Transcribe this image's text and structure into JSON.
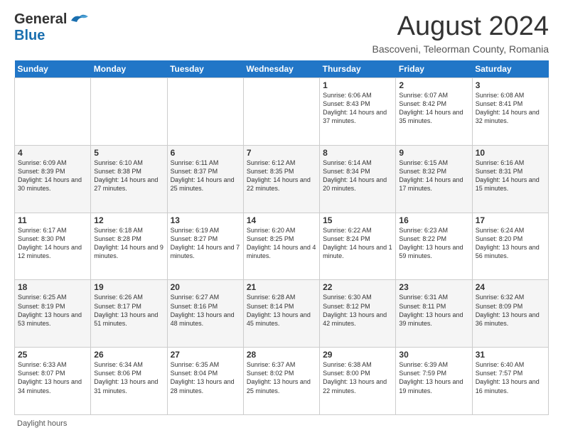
{
  "header": {
    "logo_general": "General",
    "logo_blue": "Blue",
    "title": "August 2024",
    "subtitle": "Bascoveni, Teleorman County, Romania"
  },
  "days_of_week": [
    "Sunday",
    "Monday",
    "Tuesday",
    "Wednesday",
    "Thursday",
    "Friday",
    "Saturday"
  ],
  "weeks": [
    [
      {
        "day": "",
        "info": ""
      },
      {
        "day": "",
        "info": ""
      },
      {
        "day": "",
        "info": ""
      },
      {
        "day": "",
        "info": ""
      },
      {
        "day": "1",
        "info": "Sunrise: 6:06 AM\nSunset: 8:43 PM\nDaylight: 14 hours\nand 37 minutes."
      },
      {
        "day": "2",
        "info": "Sunrise: 6:07 AM\nSunset: 8:42 PM\nDaylight: 14 hours\nand 35 minutes."
      },
      {
        "day": "3",
        "info": "Sunrise: 6:08 AM\nSunset: 8:41 PM\nDaylight: 14 hours\nand 32 minutes."
      }
    ],
    [
      {
        "day": "4",
        "info": "Sunrise: 6:09 AM\nSunset: 8:39 PM\nDaylight: 14 hours\nand 30 minutes."
      },
      {
        "day": "5",
        "info": "Sunrise: 6:10 AM\nSunset: 8:38 PM\nDaylight: 14 hours\nand 27 minutes."
      },
      {
        "day": "6",
        "info": "Sunrise: 6:11 AM\nSunset: 8:37 PM\nDaylight: 14 hours\nand 25 minutes."
      },
      {
        "day": "7",
        "info": "Sunrise: 6:12 AM\nSunset: 8:35 PM\nDaylight: 14 hours\nand 22 minutes."
      },
      {
        "day": "8",
        "info": "Sunrise: 6:14 AM\nSunset: 8:34 PM\nDaylight: 14 hours\nand 20 minutes."
      },
      {
        "day": "9",
        "info": "Sunrise: 6:15 AM\nSunset: 8:32 PM\nDaylight: 14 hours\nand 17 minutes."
      },
      {
        "day": "10",
        "info": "Sunrise: 6:16 AM\nSunset: 8:31 PM\nDaylight: 14 hours\nand 15 minutes."
      }
    ],
    [
      {
        "day": "11",
        "info": "Sunrise: 6:17 AM\nSunset: 8:30 PM\nDaylight: 14 hours\nand 12 minutes."
      },
      {
        "day": "12",
        "info": "Sunrise: 6:18 AM\nSunset: 8:28 PM\nDaylight: 14 hours\nand 9 minutes."
      },
      {
        "day": "13",
        "info": "Sunrise: 6:19 AM\nSunset: 8:27 PM\nDaylight: 14 hours\nand 7 minutes."
      },
      {
        "day": "14",
        "info": "Sunrise: 6:20 AM\nSunset: 8:25 PM\nDaylight: 14 hours\nand 4 minutes."
      },
      {
        "day": "15",
        "info": "Sunrise: 6:22 AM\nSunset: 8:24 PM\nDaylight: 14 hours\nand 1 minute."
      },
      {
        "day": "16",
        "info": "Sunrise: 6:23 AM\nSunset: 8:22 PM\nDaylight: 13 hours\nand 59 minutes."
      },
      {
        "day": "17",
        "info": "Sunrise: 6:24 AM\nSunset: 8:20 PM\nDaylight: 13 hours\nand 56 minutes."
      }
    ],
    [
      {
        "day": "18",
        "info": "Sunrise: 6:25 AM\nSunset: 8:19 PM\nDaylight: 13 hours\nand 53 minutes."
      },
      {
        "day": "19",
        "info": "Sunrise: 6:26 AM\nSunset: 8:17 PM\nDaylight: 13 hours\nand 51 minutes."
      },
      {
        "day": "20",
        "info": "Sunrise: 6:27 AM\nSunset: 8:16 PM\nDaylight: 13 hours\nand 48 minutes."
      },
      {
        "day": "21",
        "info": "Sunrise: 6:28 AM\nSunset: 8:14 PM\nDaylight: 13 hours\nand 45 minutes."
      },
      {
        "day": "22",
        "info": "Sunrise: 6:30 AM\nSunset: 8:12 PM\nDaylight: 13 hours\nand 42 minutes."
      },
      {
        "day": "23",
        "info": "Sunrise: 6:31 AM\nSunset: 8:11 PM\nDaylight: 13 hours\nand 39 minutes."
      },
      {
        "day": "24",
        "info": "Sunrise: 6:32 AM\nSunset: 8:09 PM\nDaylight: 13 hours\nand 36 minutes."
      }
    ],
    [
      {
        "day": "25",
        "info": "Sunrise: 6:33 AM\nSunset: 8:07 PM\nDaylight: 13 hours\nand 34 minutes."
      },
      {
        "day": "26",
        "info": "Sunrise: 6:34 AM\nSunset: 8:06 PM\nDaylight: 13 hours\nand 31 minutes."
      },
      {
        "day": "27",
        "info": "Sunrise: 6:35 AM\nSunset: 8:04 PM\nDaylight: 13 hours\nand 28 minutes."
      },
      {
        "day": "28",
        "info": "Sunrise: 6:37 AM\nSunset: 8:02 PM\nDaylight: 13 hours\nand 25 minutes."
      },
      {
        "day": "29",
        "info": "Sunrise: 6:38 AM\nSunset: 8:00 PM\nDaylight: 13 hours\nand 22 minutes."
      },
      {
        "day": "30",
        "info": "Sunrise: 6:39 AM\nSunset: 7:59 PM\nDaylight: 13 hours\nand 19 minutes."
      },
      {
        "day": "31",
        "info": "Sunrise: 6:40 AM\nSunset: 7:57 PM\nDaylight: 13 hours\nand 16 minutes."
      }
    ]
  ],
  "footer": {
    "daylight_label": "Daylight hours"
  }
}
